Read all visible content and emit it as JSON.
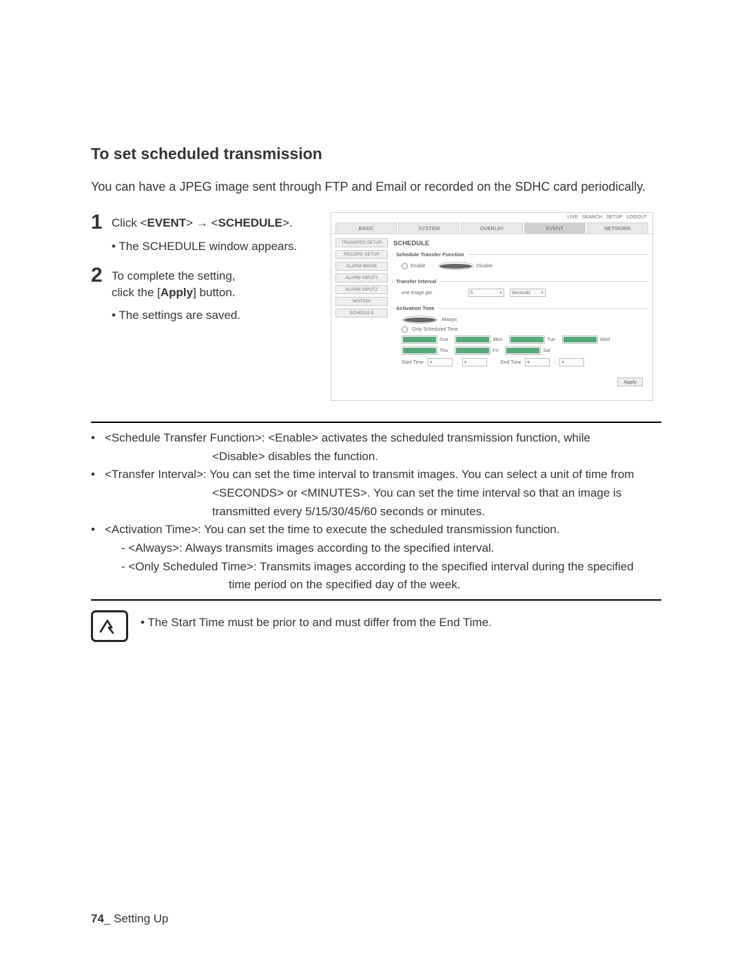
{
  "heading": "To set scheduled transmission",
  "intro": "You can have a JPEG image sent through FTP and Email or recorded on the SDHC card periodically.",
  "steps": {
    "s1": {
      "num": "1",
      "pre": "Click <",
      "event": "EVENT",
      "mid": "> ",
      "arrow": "→",
      "mid2": " <",
      "sched": "SCHEDULE",
      "post": ">.",
      "sub": "The SCHEDULE window appears."
    },
    "s2": {
      "num": "2",
      "l1": "To complete the setting,",
      "l2a": "click the [",
      "apply": "Apply",
      "l2b": "] button.",
      "sub": "The settings are saved."
    }
  },
  "shot": {
    "topnav": [
      "LIVE",
      "SEARCH",
      "SETUP",
      "LOGOUT"
    ],
    "tabs": [
      "BASIC",
      "SYSTEM",
      "OVERLAY",
      "EVENT",
      "NETWORK"
    ],
    "active_tab_index": 3,
    "side": [
      "TRANSFER SETUP",
      "RECORD SETUP",
      "ALARM IMAGE",
      "ALARM INPUT1",
      "ALARM INPUT2",
      "MOTION",
      "SCHEDULE"
    ],
    "title": "SCHEDULE",
    "fs1": {
      "legend": "Schedule Transfer Function",
      "enable": "Enable",
      "disable": "Disable"
    },
    "fs2": {
      "legend": "Transfer Interval",
      "label": "one image per",
      "value": "5",
      "unit": "Seconds"
    },
    "fs3": {
      "legend": "Activation Time",
      "always": "Always",
      "only": "Only Scheduled Time",
      "days": [
        "Sun",
        "Mon",
        "Tue",
        "Wed",
        "Thu",
        "Fri",
        "Sat"
      ],
      "start": "Start Time",
      "end": "End Time"
    },
    "apply": "Apply"
  },
  "defs": {
    "b1a": "<Schedule Transfer Function>: <Enable> activates the scheduled transmission function, while",
    "b1b": "<Disable> disables the function.",
    "b2a": "<Transfer Interval>: You can set the time interval to transmit images. You can select a unit of time from",
    "b2b": "<SECONDS> or <MINUTES>. You can set the time interval so that an image is",
    "b2c": "transmitted every 5/15/30/45/60 seconds or minutes.",
    "b3": "<Activation Time>: You can set the time to execute the scheduled transmission function.",
    "b3a": "- <Always>: Always transmits images according to the specified interval.",
    "b3b": "- <Only Scheduled Time>: Transmits images according to the specified interval during the specified",
    "b3c": "time period on the specified day of the week."
  },
  "note": "The Start Time must be prior to and must differ from the End Time.",
  "footer": {
    "page": "74",
    "sep": "_",
    "section": " Setting Up"
  }
}
